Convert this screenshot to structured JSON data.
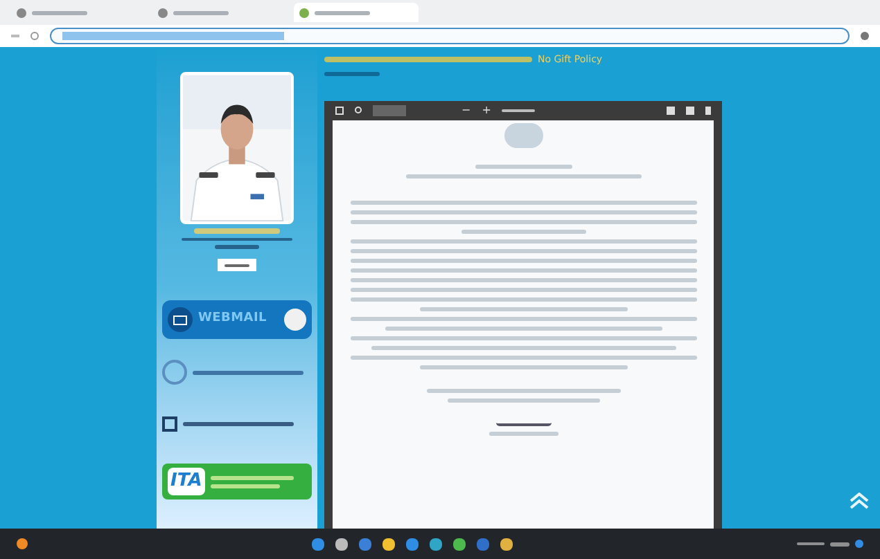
{
  "browser": {
    "tabs": [
      {
        "selected": false
      },
      {
        "selected": false
      },
      {
        "selected": true
      }
    ]
  },
  "article": {
    "title_suffix": "No Gift Policy"
  },
  "pdf_toolbar": {
    "zoom_out": "−",
    "zoom_in": "+"
  },
  "sidebar": {
    "webmail": "WEBMAIL",
    "ita": "ITA"
  }
}
